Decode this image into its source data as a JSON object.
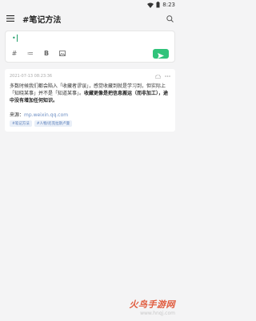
{
  "status": {
    "time": "8:23"
  },
  "app": {
    "title": "#笔记方法"
  },
  "editor": {
    "prefix": "•"
  },
  "toolbar": {
    "hash": "#",
    "list": "≔",
    "bold": "B"
  },
  "note": {
    "timestamp": "2021-07-13 08:23:36",
    "body_part1": "多数时候我们都会陷入「收藏者谬误」，感觉收藏到就是学习到，但实际上「知晓某事」并不是「知道某事」。",
    "body_bold": "收藏更像是把信息搬运（而非加工），途中没有增加任何知识。",
    "source_label": "来源：",
    "source_link": "mp.weixin.qq.com",
    "tags": [
      "#笔记方法",
      "#人物/尼克拉斯卢曼"
    ]
  },
  "watermark": {
    "title": "火鸟手游网",
    "url": "www.hnqj.com"
  },
  "colors": {
    "accent": "#30c37a",
    "link": "#6e8fc4",
    "tag_bg": "#e9eff8"
  }
}
